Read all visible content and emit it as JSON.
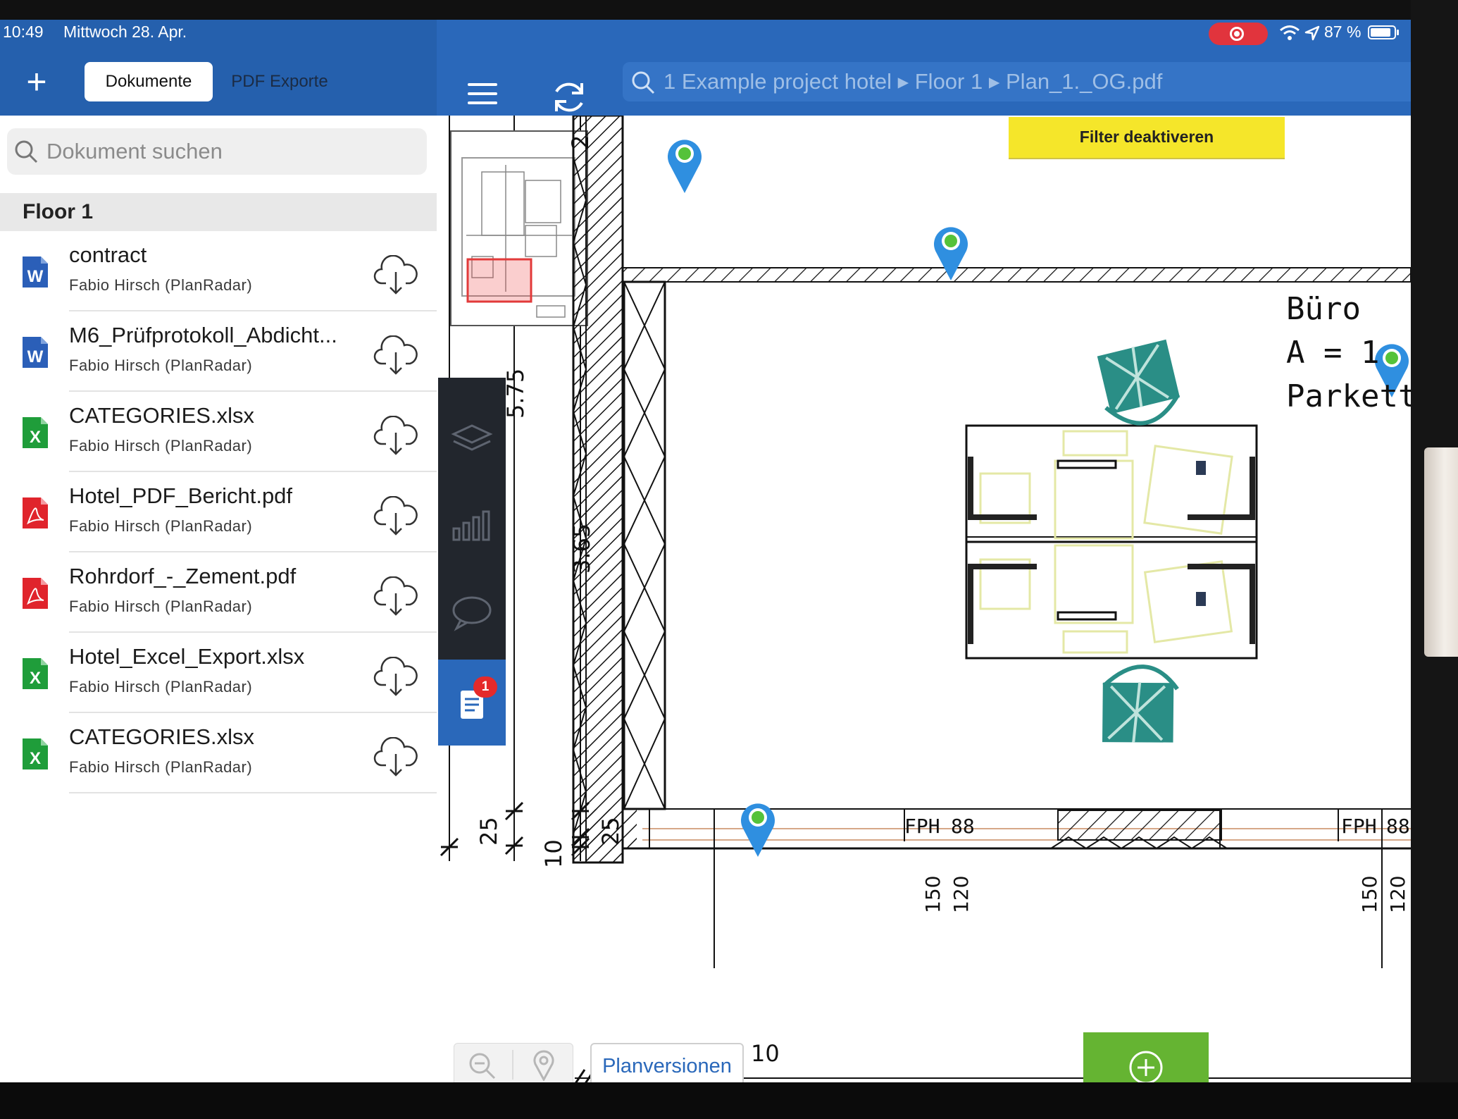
{
  "status_bar": {
    "time": "10:49",
    "date": "Mittwoch 28. Apr.",
    "battery": "87 %",
    "battery_level": 0.87
  },
  "header": {
    "tabs": [
      {
        "label": "Dokumente",
        "active": true
      },
      {
        "label": "PDF Exporte",
        "active": false
      }
    ],
    "breadcrumb": "1 Example project hotel ▸ Floor 1 ▸ Plan_1._OG.pdf"
  },
  "sidebar": {
    "search_placeholder": "Dokument suchen",
    "section_title": "Floor 1",
    "documents": [
      {
        "name": "contract",
        "author": "Fabio Hirsch (PlanRadar)",
        "type": "word"
      },
      {
        "name": "M6_Prüfprotokoll_Abdicht...",
        "author": "Fabio Hirsch (PlanRadar)",
        "type": "word"
      },
      {
        "name": "CATEGORIES.xlsx",
        "author": "Fabio Hirsch (PlanRadar)",
        "type": "excel"
      },
      {
        "name": "Hotel_PDF_Bericht.pdf",
        "author": "Fabio Hirsch (PlanRadar)",
        "type": "pdf"
      },
      {
        "name": "Rohrdorf_-_Zement.pdf",
        "author": "Fabio Hirsch (PlanRadar)",
        "type": "pdf"
      },
      {
        "name": "Hotel_Excel_Export.xlsx",
        "author": "Fabio Hirsch (PlanRadar)",
        "type": "excel"
      },
      {
        "name": "CATEGORIES.xlsx",
        "author": "Fabio Hirsch (PlanRadar)",
        "type": "excel"
      }
    ]
  },
  "tools": {
    "badge_count": "1"
  },
  "plan": {
    "filter_button": "Filter deaktiveren",
    "room_text": "Büro\nA = 1\nParkett",
    "dimensions": {
      "d575": "5.75",
      "d365": "3.65",
      "d25a": "25",
      "d10a": "10",
      "d25b": "25",
      "fph_left": "FPH",
      "fph_left_val": "88",
      "fph_right": "FPH",
      "fph_right_val": "88",
      "d150a": "150",
      "d120a": "120",
      "d150b": "150",
      "d120b": "120",
      "d10b": "10",
      "d2": "2"
    }
  },
  "bottom_bar": {
    "plan_versions_label": "Planversionen"
  },
  "colors": {
    "header_blue": "#2a68ba",
    "filter_yellow": "#f5e62a",
    "add_green": "#65b432",
    "badge_red": "#e52a2a",
    "word_blue": "#2b5fb8",
    "excel_green": "#1f9d3a",
    "pdf_red": "#e0242c"
  },
  "icons": [
    "plus-icon",
    "menu-icon",
    "sync-icon",
    "search-icon",
    "cloud-download-icon",
    "layers-icon",
    "chart-icon",
    "chat-icon",
    "document-icon",
    "zoom-out-icon",
    "location-pin-icon",
    "add-circle-icon",
    "word-file-icon",
    "excel-file-icon",
    "pdf-file-icon",
    "wifi-icon",
    "location-arrow-icon",
    "battery-icon",
    "record-icon"
  ]
}
